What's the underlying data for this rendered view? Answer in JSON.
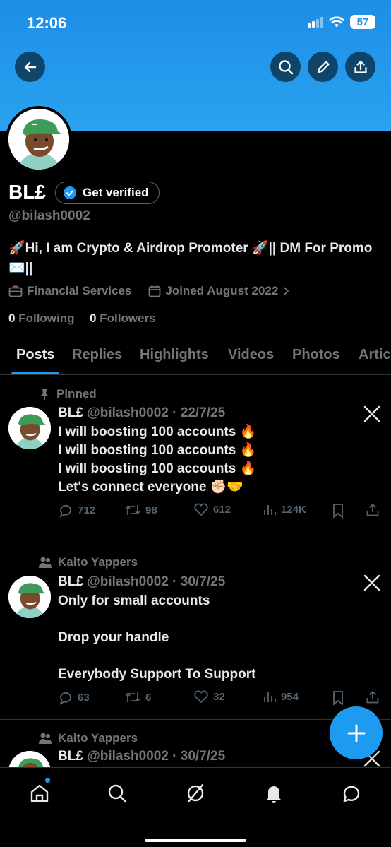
{
  "status_bar": {
    "time": "12:06",
    "battery": "57"
  },
  "header": {
    "back_icon": "arrow-left-icon",
    "search_icon": "search-icon",
    "edit_icon": "pencil-icon",
    "share_icon": "share-icon"
  },
  "profile": {
    "name": "BL£",
    "verify_label": "Get verified",
    "handle": "@bilash0002",
    "bio": "🚀Hi, I am Crypto & Airdrop Promoter 🚀|| DM For Promo✉️||",
    "category": "Financial Services",
    "joined": "Joined August 2022",
    "following_count": "0",
    "following_label": "Following",
    "followers_count": "0",
    "followers_label": "Followers"
  },
  "tabs": [
    {
      "label": "Posts",
      "active": true
    },
    {
      "label": "Replies"
    },
    {
      "label": "Highlights"
    },
    {
      "label": "Videos"
    },
    {
      "label": "Photos"
    },
    {
      "label": "Articles"
    }
  ],
  "posts": [
    {
      "context": "Pinned",
      "name": "BL£",
      "handle": "@bilash0002",
      "date": "· 22/7/25",
      "text": "I will boosting 100 accounts 🔥\nI will boosting 100 accounts 🔥\nI will boosting 100 accounts 🔥\nLet's connect everyone ✊🏻🤝",
      "replies": "712",
      "reposts": "98",
      "likes": "612",
      "views": "124K"
    },
    {
      "context": "Kaito Yappers",
      "name": "BL£",
      "handle": "@bilash0002",
      "date": "· 30/7/25",
      "text": "Only for small accounts\n\nDrop your handle\n\nEverybody Support To Support",
      "replies": "63",
      "reposts": "6",
      "likes": "32",
      "views": "954"
    },
    {
      "context": "Kaito Yappers",
      "name": "BL£",
      "handle": "@bilash0002",
      "date": "· 30/7/25"
    }
  ],
  "colors": {
    "accent": "#1d9bf0",
    "banner": "#1d8fe6",
    "muted": "#71767b"
  }
}
